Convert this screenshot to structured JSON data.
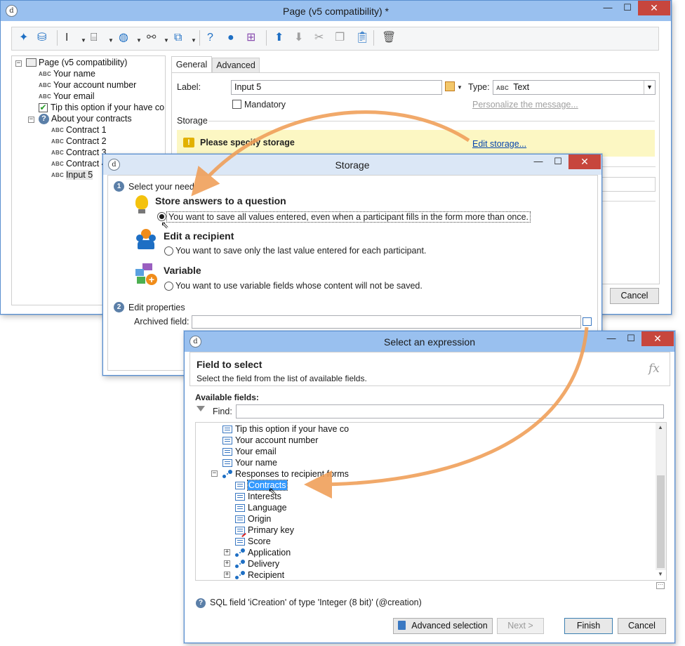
{
  "page_window": {
    "title": "Page (v5 compatibility) *",
    "tree": {
      "root": "Page (v5 compatibility)",
      "items": [
        {
          "badge": "ABC",
          "label": "Your name"
        },
        {
          "badge": "ABC",
          "label": "Your account number"
        },
        {
          "badge": "ABC",
          "label": "Your email"
        },
        {
          "badge": "check",
          "label": "Tip this option if your have co"
        }
      ],
      "group": "About your contracts",
      "group_items": [
        {
          "badge": "ABC",
          "label": "Contract 1"
        },
        {
          "badge": "ABC",
          "label": "Contract 2"
        },
        {
          "badge": "ABC",
          "label": "Contract 3"
        },
        {
          "badge": "ABC",
          "label": "Contract 4"
        },
        {
          "badge": "ABC",
          "label": "Input 5"
        }
      ]
    },
    "tabs": [
      "General",
      "Advanced"
    ],
    "label_caption": "Label:",
    "label_value": "Input 5",
    "type_caption": "Type:",
    "type_badge": "ABC",
    "type_value": "Text",
    "mandatory_label": "Mandatory",
    "personalize_link": "Personalize the message...",
    "storage_caption": "Storage",
    "warning_text": "Please specify storage",
    "edit_storage_link": "Edit storage...",
    "cancel_label": "Cancel"
  },
  "storage_window": {
    "title": "Storage",
    "step1_number": "1",
    "step1_label": "Select your need",
    "options": [
      {
        "title": "Store answers to a question",
        "desc": "You want to save all values entered, even when a participant fills in the form more than once.",
        "checked": true
      },
      {
        "title": "Edit a recipient",
        "desc": "You want to save only the last value entered for each participant.",
        "checked": false
      },
      {
        "title": "Variable",
        "desc": "You want to use variable fields whose content will not be saved.",
        "checked": false
      }
    ],
    "step2_number": "2",
    "step2_label": "Edit properties",
    "archived_label": "Archived field:"
  },
  "expression_window": {
    "title": "Select an expression",
    "heading": "Field to select",
    "subheading": "Select the field from the list of available fields.",
    "fx": "fx",
    "available_label": "Available fields:",
    "find_label": "Find:",
    "fields": [
      {
        "icon": "list",
        "label": "Tip this option if your have co"
      },
      {
        "icon": "list",
        "label": "Your account number"
      },
      {
        "icon": "list",
        "label": "Your email"
      },
      {
        "icon": "list",
        "label": "Your name"
      },
      {
        "icon": "link",
        "label": "Responses to recipient forms",
        "expander": "−"
      },
      {
        "icon": "list",
        "label": "Contracts",
        "selected": true
      },
      {
        "icon": "list",
        "label": "Interests"
      },
      {
        "icon": "list",
        "label": "Language"
      },
      {
        "icon": "list",
        "label": "Origin"
      },
      {
        "icon": "key",
        "label": "Primary key"
      },
      {
        "icon": "list",
        "label": "Score"
      },
      {
        "icon": "link",
        "label": "Application",
        "expander": "+"
      },
      {
        "icon": "link",
        "label": "Delivery",
        "expander": "+"
      },
      {
        "icon": "link",
        "label": "Recipient",
        "expander": "+"
      }
    ],
    "status_text": "SQL field 'iCreation' of type 'Integer (8 bit)' (@creation)",
    "buttons": {
      "advanced": "Advanced selection",
      "next": "Next >",
      "finish": "Finish",
      "cancel": "Cancel"
    }
  },
  "colors": {
    "title_active": "#99c0ef",
    "title_inactive": "#dbe7f6",
    "warning_bg": "#fcf7c3",
    "arrow": "#f0a05a",
    "selection": "#3399ff",
    "link": "#0645ad"
  }
}
